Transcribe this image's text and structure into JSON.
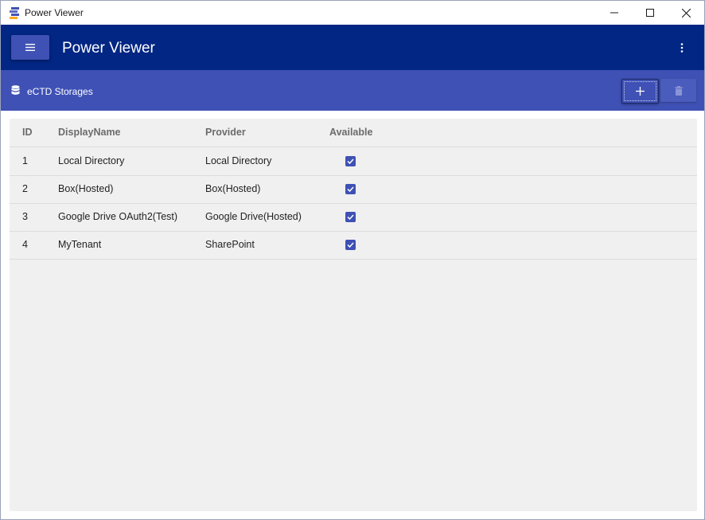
{
  "window": {
    "title": "Power Viewer"
  },
  "appbar": {
    "title": "Power Viewer"
  },
  "toolbar": {
    "title": "eCTD Storages"
  },
  "table": {
    "headers": [
      "ID",
      "DisplayName",
      "Provider",
      "Available"
    ],
    "rows": [
      {
        "id": "1",
        "display_name": "Local Directory",
        "provider": "Local Directory",
        "available": true
      },
      {
        "id": "2",
        "display_name": "Box(Hosted)",
        "provider": "Box(Hosted)",
        "available": true
      },
      {
        "id": "3",
        "display_name": "Google Drive OAuth2(Test)",
        "provider": "Google Drive(Hosted)",
        "available": true
      },
      {
        "id": "4",
        "display_name": "MyTenant",
        "provider": "SharePoint",
        "available": true
      }
    ]
  },
  "icons": {
    "app": "power-viewer-logo-icon",
    "minimize": "minimize-icon",
    "maximize": "maximize-icon",
    "close": "close-icon",
    "menu": "hamburger-menu-icon",
    "more": "more-vertical-icon",
    "database": "database-icon",
    "add": "plus-icon",
    "delete": "trash-icon",
    "check": "check-icon"
  },
  "colors": {
    "appbar": "#012683",
    "toolbar": "#3f51b5",
    "content_bg": "#f0f0f0",
    "checkbox": "#3f51b5"
  }
}
